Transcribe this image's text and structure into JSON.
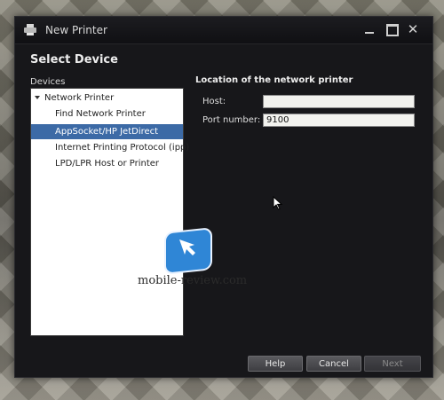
{
  "window": {
    "title": "New Printer",
    "page_heading": "Select Device"
  },
  "devices": {
    "label": "Devices",
    "tree": {
      "parent": "Network Printer",
      "children": [
        "Find Network Printer",
        "AppSocket/HP JetDirect",
        "Internet Printing Protocol (ipp)",
        "LPD/LPR Host or Printer"
      ],
      "selected_index": 1
    }
  },
  "location": {
    "title": "Location of the network printer",
    "host_label": "Host:",
    "host_value": "",
    "port_label": "Port number:",
    "port_value": "9100"
  },
  "watermark": {
    "text": "mobile-review.com"
  },
  "buttons": {
    "help": "Help",
    "cancel": "Cancel",
    "next": "Next"
  },
  "colors": {
    "selection": "#3c6aa6",
    "window_bg": "#17171a",
    "watermark_blue": "#2f86d6"
  }
}
